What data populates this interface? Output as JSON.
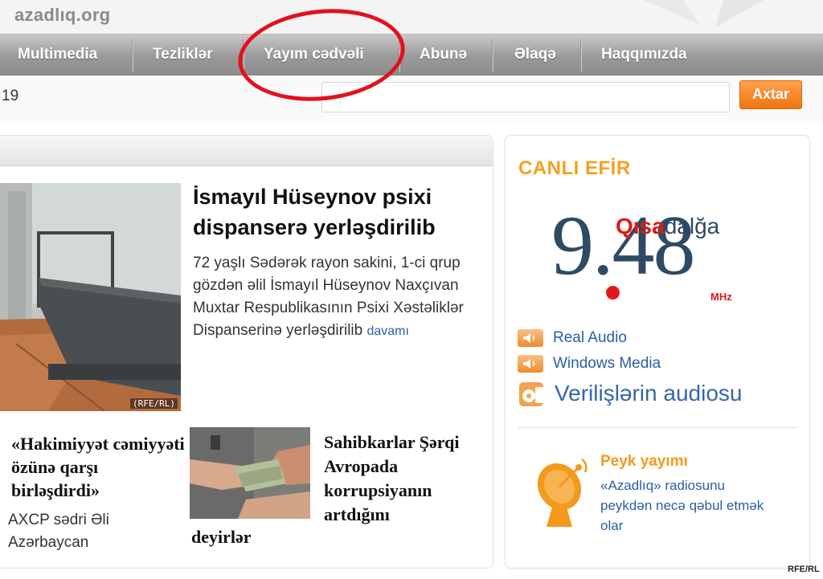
{
  "header": {
    "site_name": "azadlıq.org"
  },
  "nav": {
    "items": [
      {
        "label": "Multimedia"
      },
      {
        "label": "Tezliklər"
      },
      {
        "label": "Yayım cədvəli"
      },
      {
        "label": "Abunə"
      },
      {
        "label": "Əlaqə"
      },
      {
        "label": "Haqqımızda"
      }
    ]
  },
  "search": {
    "date_text": "19",
    "button_label": "Axtar"
  },
  "lead": {
    "title": "İsmayıl Hüseynov psixi dispanserə yerləşdirilib",
    "text": "72 yaşlı Sədərək rayon sakini, 1-ci qrup gözdən əlil İsmayıl Hüseynov Naxçıvan Muxtar Respublikasının Psixi Xəstəliklər Dispanserinə yerləşdirilib",
    "more_label": "davamı",
    "photo_credit": "(RFE/RL)"
  },
  "story2": {
    "title": "«Hakimiyyət cəmiyyəti özünə qarşı birləşdirdi»",
    "text": "AXCP sədri Əli Azərbaycan"
  },
  "story3": {
    "title": "Sahibkarlar Şərqi Avropada korrupsiyanın artdığını",
    "title_tail": "deyirlər"
  },
  "sidebar": {
    "live_title": "CANLI EFİR",
    "frequency": {
      "number": "9.48",
      "band_part1": "Qısa",
      "band_part2": "dalğa",
      "unit": "MHz"
    },
    "audio_links": [
      {
        "label": "Real Audio",
        "icon": "speaker-icon"
      },
      {
        "label": "Windows Media",
        "icon": "speaker-icon"
      }
    ],
    "audio_archive_label": "Verilişlərin audiosu",
    "satellite": {
      "title": "Peyk yayımı",
      "text": "«Azadlıq» radiosunu peykdən necə qəbul etmək olar"
    }
  },
  "watermark": "RFE/RL",
  "colors": {
    "accent_orange": "#f07410",
    "link_blue": "#2a5ea6",
    "frequency_red": "#e01818",
    "frequency_navy": "#2f4a63",
    "highlight_circle": "#e3111c"
  }
}
